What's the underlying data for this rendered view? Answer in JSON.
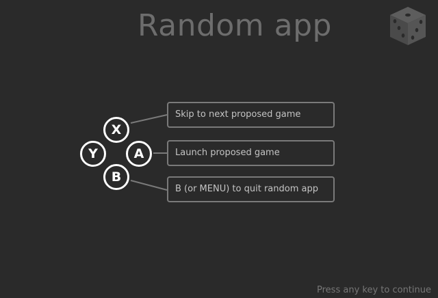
{
  "app": {
    "title": "Random app"
  },
  "icons": {
    "logo": "dice-icon"
  },
  "controls": [
    {
      "key": "X",
      "description": "Skip to next proposed game"
    },
    {
      "key": "Y",
      "description": ""
    },
    {
      "key": "A",
      "description": "Launch proposed game"
    },
    {
      "key": "B",
      "description": "B (or MENU) to quit random app"
    }
  ],
  "footer": {
    "prompt": "Press any key to continue"
  },
  "colors": {
    "background": "#2a2a2a",
    "title": "#6d6d6d",
    "button": "#ffffff",
    "hint_border": "#7a7a7a",
    "hint_text": "#c4c4c4",
    "footer_text": "#777777"
  }
}
